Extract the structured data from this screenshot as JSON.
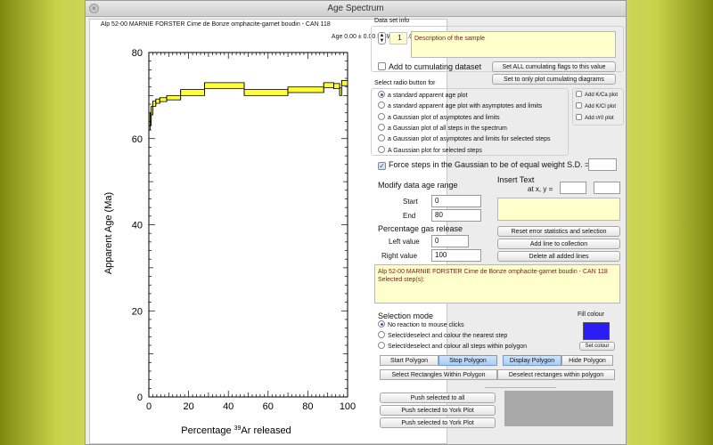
{
  "window": {
    "title": "Age Spectrum"
  },
  "plot": {
    "title": "Alp 52-00 MARNIE FORSTER Cime de Bonze omphacite-garnet boudin - CAN 118",
    "stats": "Age 0.00 ± 0.00  MSWD = 0.00"
  },
  "chart_data": {
    "type": "age-spectrum",
    "xlabel_prefix": "Percentage ",
    "xlabel_sup": "39",
    "xlabel_suffix": "Ar released",
    "ylabel": "Apparent Age (Ma)",
    "xlim": [
      0,
      100
    ],
    "ylim": [
      0,
      80
    ],
    "x_ticks": [
      0,
      20,
      40,
      60,
      80,
      100
    ],
    "y_ticks": [
      0,
      20,
      40,
      60,
      80
    ],
    "steps": [
      {
        "x0": 0.0,
        "x1": 0.6,
        "lo": 62.0,
        "hi": 63.0
      },
      {
        "x0": 0.6,
        "x1": 1.2,
        "lo": 63.0,
        "hi": 66.0
      },
      {
        "x0": 1.2,
        "x1": 2.0,
        "lo": 65.5,
        "hi": 67.5
      },
      {
        "x0": 2.0,
        "x1": 3.5,
        "lo": 67.5,
        "hi": 68.7
      },
      {
        "x0": 3.5,
        "x1": 5.5,
        "lo": 68.2,
        "hi": 69.2
      },
      {
        "x0": 5.5,
        "x1": 9.0,
        "lo": 68.6,
        "hi": 69.5
      },
      {
        "x0": 9.0,
        "x1": 16.0,
        "lo": 69.0,
        "hi": 70.0
      },
      {
        "x0": 16.0,
        "x1": 28.0,
        "lo": 70.0,
        "hi": 71.4
      },
      {
        "x0": 28.0,
        "x1": 48.0,
        "lo": 71.6,
        "hi": 73.0
      },
      {
        "x0": 48.0,
        "x1": 70.0,
        "lo": 70.0,
        "hi": 71.4
      },
      {
        "x0": 70.0,
        "x1": 88.0,
        "lo": 70.7,
        "hi": 72.0
      },
      {
        "x0": 88.0,
        "x1": 93.0,
        "lo": 71.8,
        "hi": 73.0
      },
      {
        "x0": 93.0,
        "x1": 96.0,
        "lo": 71.6,
        "hi": 72.8
      },
      {
        "x0": 96.0,
        "x1": 97.0,
        "lo": 70.0,
        "hi": 71.8
      },
      {
        "x0": 97.0,
        "x1": 100.0,
        "lo": 72.3,
        "hi": 73.5
      }
    ]
  },
  "dataset": {
    "section_label": "Data set info",
    "sample_number": "1",
    "description": "Description of the sample",
    "add_cumulating_label": "Add to cumulating dataset",
    "set_all_cumulating_button": "Set ALL cumulating flags to this value",
    "set_only_cumulating_button": "Set to only plot cumulating diagrams"
  },
  "plot_type": {
    "heading": "Select radio button for",
    "options": [
      "a standard apparent age plot",
      "a standard apparent age plot with asymptotes and limits",
      "a Gaussian plot of asymptotes and limits",
      "a Gaussian plot of all steps in the spectrum",
      "a Gaussian plot of asymptotes and limits for selected steps",
      "A Gaussian plot for selected steps"
    ],
    "selected_index": 0,
    "extra_checks": [
      "Add K/Ca plot",
      "Add K/Cl plot",
      "Add r/r0 plot"
    ]
  },
  "force_steps": {
    "label": "Force steps in the Gaussian to be of equal weight S.D. =",
    "value": ""
  },
  "age_range": {
    "heading": "Modify data age range",
    "start_label": "Start",
    "start_value": "0",
    "end_label": "End",
    "end_value": "80"
  },
  "insert_text": {
    "heading": "Insert Text",
    "coords_label": "at x, y =",
    "x_value": "",
    "y_value": "",
    "text_value": ""
  },
  "gas_release": {
    "heading": "Percentage gas release",
    "left_label": "Left value",
    "left_value": "0",
    "right_label": "Right value",
    "right_value": "100"
  },
  "actions": {
    "reset_error": "Reset error statistics and selection",
    "add_line": "Add line to collection",
    "delete_lines": "Delete all added lines"
  },
  "selected_steps_text": "Alp 52-00 MARNIE FORSTER Cime de Bonze omphacite-garnet boudin - CAN 118 Selected step(s):",
  "selection_mode": {
    "heading": "Selection mode",
    "options": [
      "No reaction to mouse clicks",
      "Select/deselect and colour the nearest step",
      "Select/deselect and colour all steps within polygon"
    ],
    "selected_index": 0,
    "fill_colour_label": "Fill colour",
    "fill_colour": "#2a1cf5",
    "set_colour_button": "Set colour"
  },
  "polygon": {
    "start": "Start Polygon",
    "stop": "Stop Polygon",
    "display": "Display Polygon",
    "hide": "Hide Polygon",
    "select_rects": "Select Rectangles Within Polygon",
    "deselect_rects": "Deselect rectanges within polygon"
  },
  "push": {
    "all": "Push selected to all",
    "york1": "Push selected to York Plot",
    "york2": "Push selected to York Plot"
  },
  "colors": {
    "step_fill": "#ffff33",
    "accent": "#2b5ec9"
  }
}
